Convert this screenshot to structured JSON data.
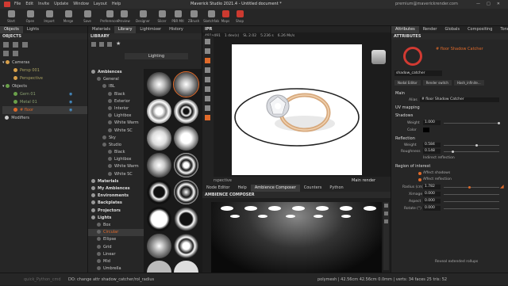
{
  "title_bar": {
    "menus": [
      "File",
      "Edit",
      "Invite",
      "Update",
      "Window",
      "Layout",
      "Help"
    ],
    "title": "Maverick Studio 2021.4 - Untitled document *",
    "user": "premium@maverickrender.com"
  },
  "toolbar": {
    "items": [
      "Start",
      "Open",
      "Import",
      "Merge",
      "Save",
      "Preferences",
      "Preview",
      "Designer",
      "Slicer",
      "PBR Mtl",
      "ZBrush",
      "Sketchfab",
      "Maps",
      "Shop"
    ]
  },
  "objects_panel": {
    "tabs": [
      "Objects",
      "Lights"
    ],
    "header": "OBJECTS",
    "cameras_label": "Cameras",
    "cameras": [
      "Persp 001",
      "Perspective"
    ],
    "objects_label": "Objects",
    "objects": [
      "Gem 01",
      "Metal 01",
      "# floor"
    ],
    "modifiers_label": "Modifiers"
  },
  "library_panel": {
    "tabs": [
      "Materials",
      "Library",
      "Lightmixer",
      "History"
    ],
    "header": "LIBRARY",
    "filter": "Lighting",
    "tree": [
      {
        "label": "Ambiences",
        "level": 0,
        "bold": true
      },
      {
        "label": "General",
        "level": 1
      },
      {
        "label": "IBL",
        "level": 2
      },
      {
        "label": "Black",
        "level": 3
      },
      {
        "label": "Exterior",
        "level": 3
      },
      {
        "label": "Interior",
        "level": 3
      },
      {
        "label": "Lightbox",
        "level": 3
      },
      {
        "label": "White Warm",
        "level": 3
      },
      {
        "label": "White SC",
        "level": 3
      },
      {
        "label": "Sky",
        "level": 2
      },
      {
        "label": "Studio",
        "level": 2
      },
      {
        "label": "Black",
        "level": 3
      },
      {
        "label": "Lightbox",
        "level": 3
      },
      {
        "label": "White Warm",
        "level": 3
      },
      {
        "label": "White SC",
        "level": 3
      },
      {
        "label": "Materials",
        "level": 0,
        "bold": true
      },
      {
        "label": "My Ambiences",
        "level": 0,
        "bold": true
      },
      {
        "label": "Environments",
        "level": 0,
        "bold": true
      },
      {
        "label": "Backplates",
        "level": 0,
        "bold": true
      },
      {
        "label": "Projectors",
        "level": 0,
        "bold": true
      },
      {
        "label": "Lights",
        "level": 0,
        "bold": true
      },
      {
        "label": "Box",
        "level": 1
      },
      {
        "label": "Circular",
        "level": 1,
        "selected": true
      },
      {
        "label": "Ellipse",
        "level": 1
      },
      {
        "label": "Grid",
        "level": 1
      },
      {
        "label": "Linear",
        "level": 1
      },
      {
        "label": "Mid",
        "level": 1
      },
      {
        "label": "Umbrella",
        "level": 1
      }
    ]
  },
  "viewport": {
    "header": "IPR",
    "stats": [
      "491x491",
      "1 dev(s)",
      "SL 2.02",
      "5.236 s",
      "6.26 Ms/s"
    ],
    "camera": "Perspective",
    "render_mode": "Main render"
  },
  "composer": {
    "tabs": [
      "Node Editor",
      "Help",
      "Ambience Composer",
      "Counters",
      "Python"
    ],
    "header": "AMBIENCE COMPOSER"
  },
  "attributes": {
    "tabs": [
      "Attributes",
      "Render",
      "Globals",
      "Compositing",
      "Tonemap"
    ],
    "header": "ATTRIBUTES",
    "name": "# floor Shadow Catcher",
    "material_name": "shadow_catcher",
    "buttons": [
      "Nodal Editor",
      "Render switch",
      "Hash_infinite..."
    ],
    "sections": [
      {
        "title": "Main",
        "fields": [
          {
            "label": "Alias",
            "value": "# floor Shadow Catcher"
          }
        ]
      },
      {
        "title": "UV mapping"
      },
      {
        "title": "Shadows",
        "fields": [
          {
            "label": "Weight",
            "value": "1.000"
          },
          {
            "label": "Color",
            "value": ""
          }
        ]
      },
      {
        "title": "Reflection",
        "fields": [
          {
            "label": "Weight",
            "value": "0.584"
          },
          {
            "label": "Roughness",
            "value": "0.148"
          }
        ],
        "toggles": [
          "Indirect reflection"
        ]
      },
      {
        "title": "Region of interest",
        "toggles": [
          "Affect shadows",
          "Affect reflection"
        ],
        "fields": [
          {
            "label": "Radius (cm)",
            "value": "1.782"
          },
          {
            "label": "Ximage",
            "value": "0.000"
          },
          {
            "label": "Aspect",
            "value": "0.000"
          },
          {
            "label": "Rotate (°)",
            "value": "0.000"
          }
        ]
      }
    ],
    "reveal": "Reveal extended rollups"
  },
  "levels": {
    "shadows_weight": 1.0,
    "reflection_weight": 0.584,
    "roughness": 0.148,
    "radius": 0.45
  },
  "colors": {
    "accent": "#e06a2a",
    "brand": "#d23a32"
  },
  "status": {
    "left": "quick_Python_cmd",
    "message": "DO: change attr shadow_catcher/rol_radius",
    "right": "polymesh | 42.56cm 42.56cm 0.0mm | verts: 34 faces 25 tris: 52"
  }
}
